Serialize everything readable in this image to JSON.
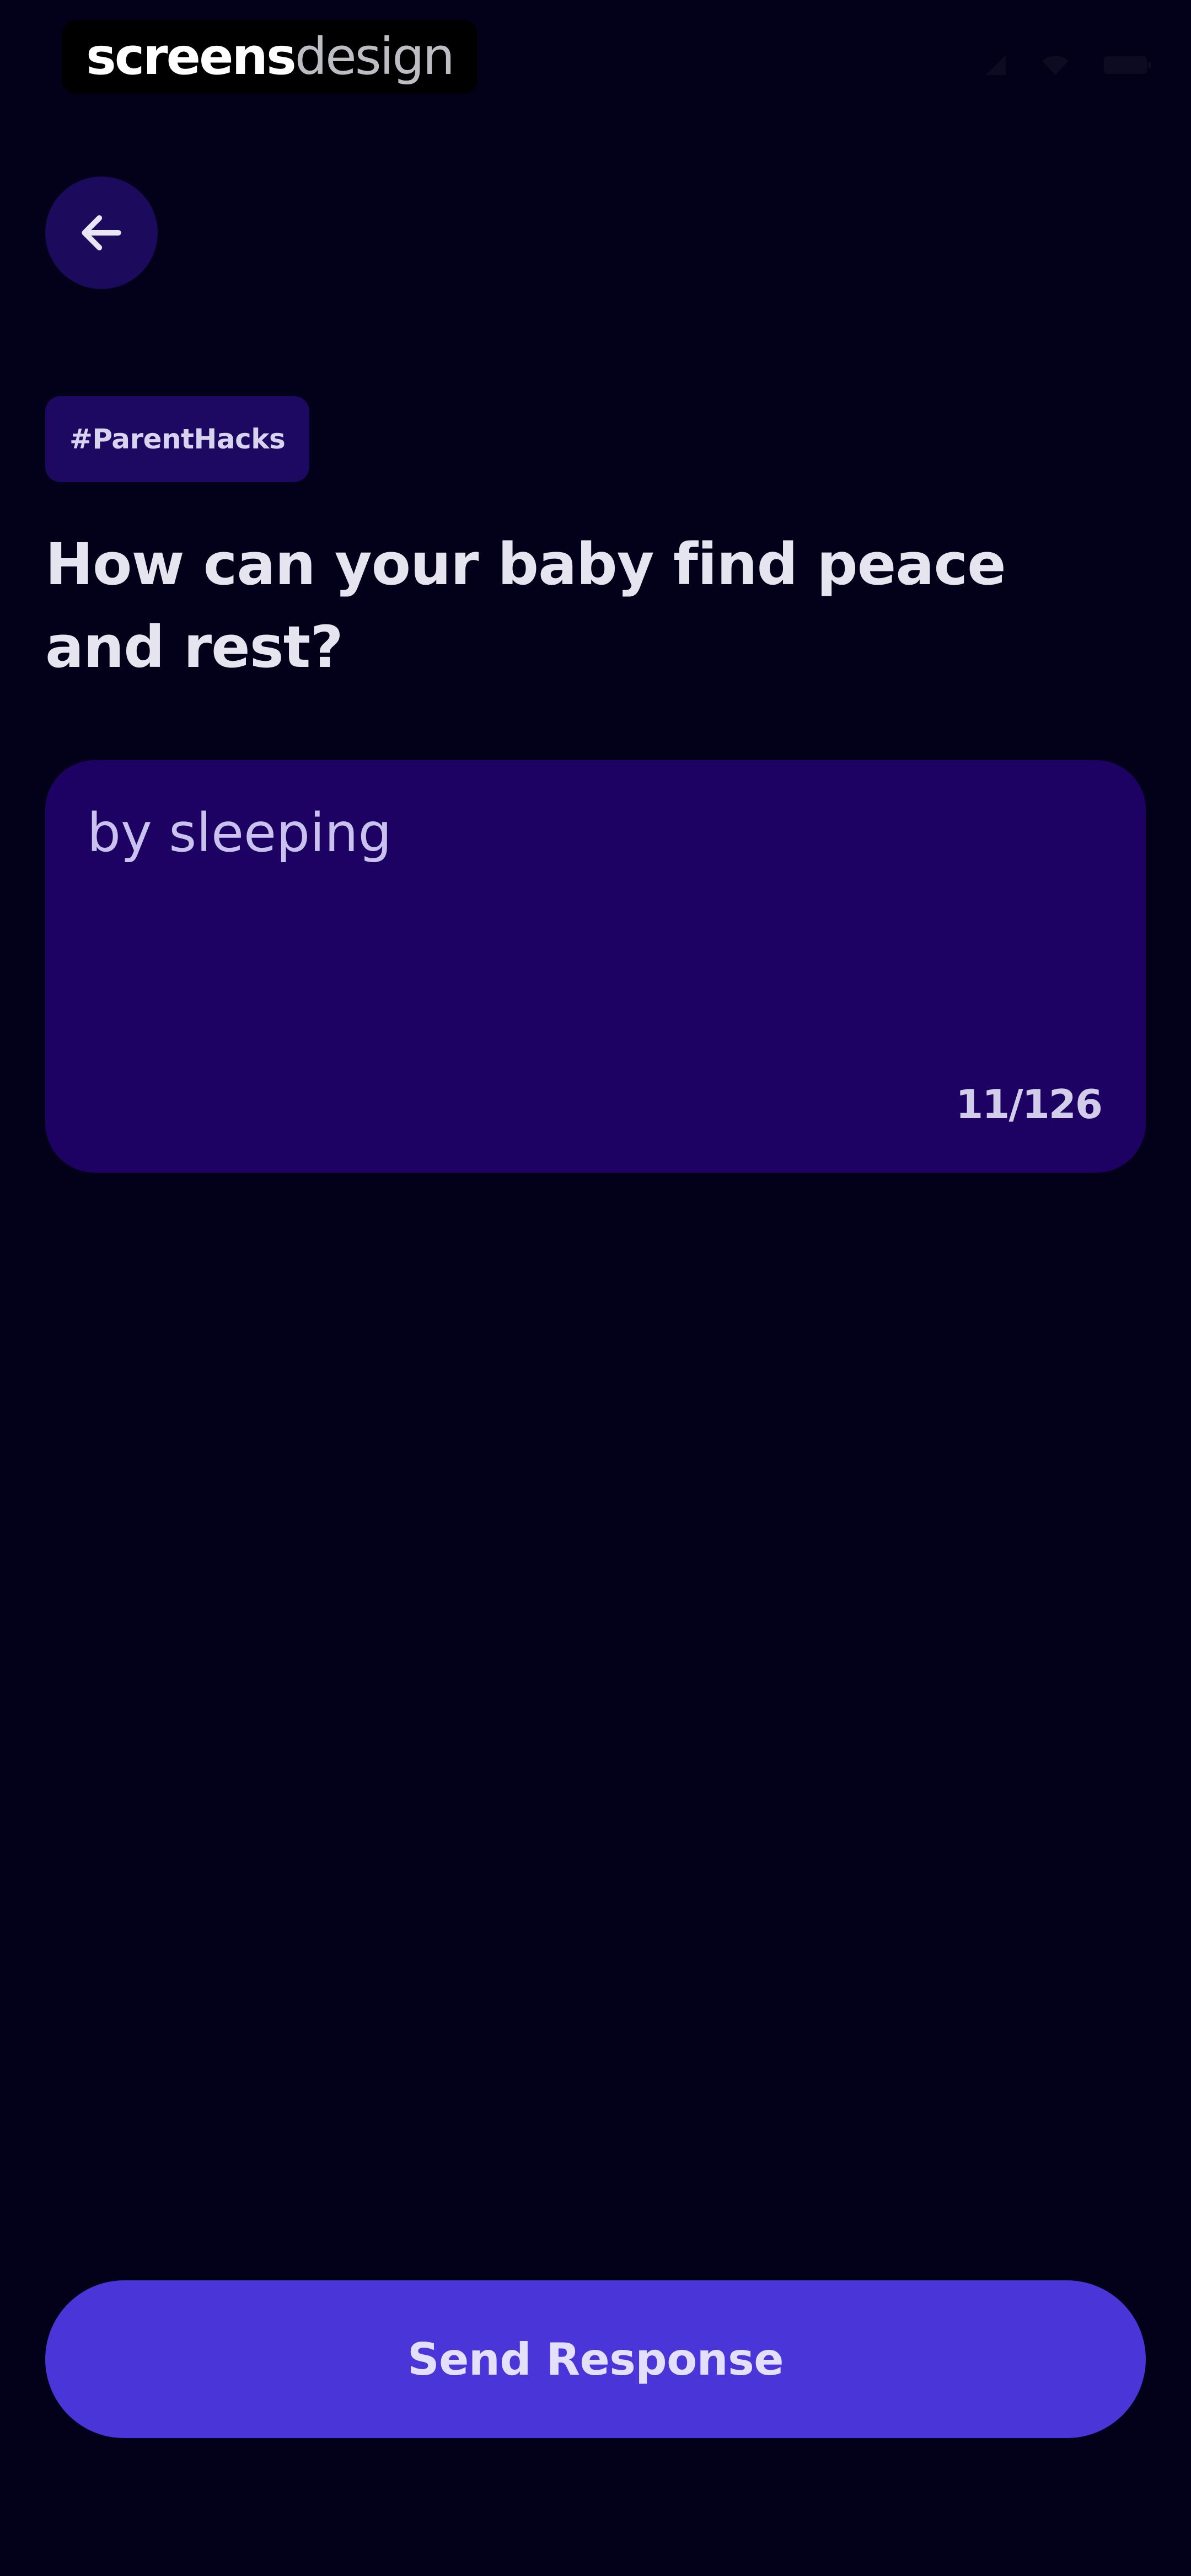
{
  "brand": {
    "strong": "screens",
    "light": "design"
  },
  "status_bar": {
    "icons": [
      "signal-icon",
      "wifi-icon",
      "battery-icon"
    ]
  },
  "back_button": {
    "icon": "arrow-left-icon"
  },
  "hashtag": "#ParentHacks",
  "question": "How can your baby find peace and rest?",
  "response": {
    "value": "by sleeping",
    "counter": "11/126"
  },
  "send_button": {
    "label": "Send Response"
  },
  "colors": {
    "background": "#03001a",
    "surface": "#1d0263",
    "accent": "#4a36d8",
    "chip": "#1d0862"
  }
}
